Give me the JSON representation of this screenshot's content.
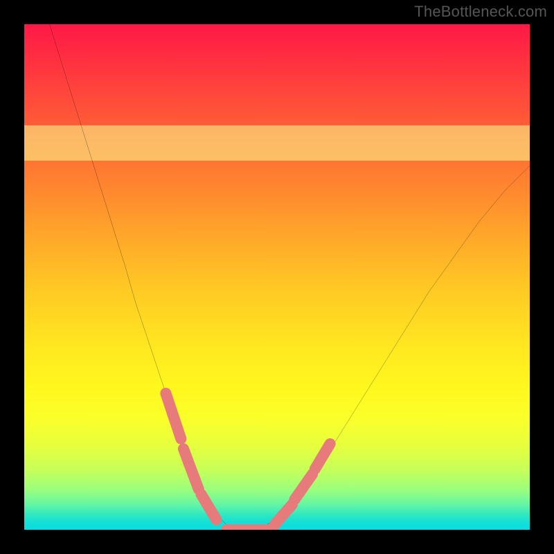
{
  "watermark": "TheBottleneck.com",
  "colors": {
    "frame": "#000000",
    "curve": "#000000",
    "marker": "#e77b7b",
    "gradient_top": "#ff1846",
    "gradient_bottom": "#08dce0"
  },
  "chart_data": {
    "type": "line",
    "title": "",
    "xlabel": "",
    "ylabel": "",
    "xlim": [
      0,
      100
    ],
    "ylim": [
      0,
      100
    ],
    "annotations": [
      "TheBottleneck.com"
    ],
    "legend": [],
    "grid": false,
    "series": [
      {
        "name": "bottleneck-curve",
        "x": [
          5,
          10,
          15,
          20,
          22,
          25,
          28,
          30,
          32,
          34,
          36,
          38,
          40,
          42,
          45,
          48,
          52,
          56,
          60,
          65,
          70,
          75,
          80,
          85,
          90,
          95,
          100
        ],
        "y": [
          100,
          84,
          68,
          52,
          45,
          36,
          27,
          21,
          15,
          10,
          6,
          3,
          1,
          0,
          0,
          1,
          4,
          9,
          15,
          23,
          31,
          39,
          47,
          54,
          61,
          67,
          72
        ]
      }
    ],
    "markers": {
      "name": "highlighted-range",
      "color": "#e77b7b",
      "segments": [
        {
          "x": [
            28,
            31
          ],
          "y": [
            27,
            18
          ]
        },
        {
          "x": [
            31.5,
            34.5
          ],
          "y": [
            16,
            8
          ]
        },
        {
          "x": [
            35,
            38
          ],
          "y": [
            7,
            2
          ]
        },
        {
          "x": [
            40,
            49
          ],
          "y": [
            0,
            0
          ]
        },
        {
          "x": [
            49.5,
            53
          ],
          "y": [
            1,
            5
          ]
        },
        {
          "x": [
            53.5,
            57
          ],
          "y": [
            6,
            11
          ]
        },
        {
          "x": [
            57.5,
            60.5
          ],
          "y": [
            12,
            17
          ]
        }
      ]
    },
    "background": {
      "type": "vertical-gradient",
      "stops": [
        {
          "pos": 0,
          "color": "#ff1846"
        },
        {
          "pos": 24,
          "color": "#ff6a34"
        },
        {
          "pos": 52,
          "color": "#ffc824"
        },
        {
          "pos": 78,
          "color": "#fbff2a"
        },
        {
          "pos": 92,
          "color": "#9cff7c"
        },
        {
          "pos": 100,
          "color": "#08dce0"
        }
      ],
      "pale_band_y": [
        73,
        80
      ]
    }
  }
}
